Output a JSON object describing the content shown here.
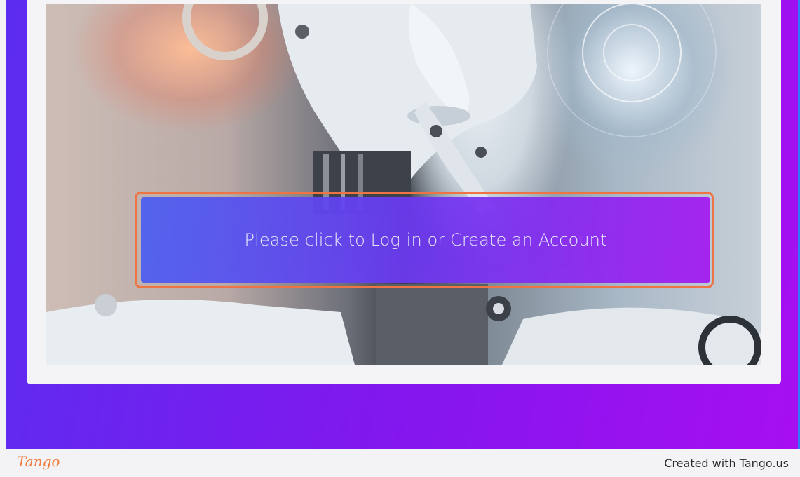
{
  "hero": {
    "cta_label": "Please click to Log-in or Create an Account",
    "image_subject": "robot-face-image"
  },
  "footer": {
    "logo_text": "Tango",
    "credit_text": "Created with Tango.us"
  },
  "colors": {
    "gradient_start": "#5b2df0",
    "gradient_end": "#a70ff0",
    "highlight_ring": "#ee7443",
    "brand": "#f07a3c"
  }
}
